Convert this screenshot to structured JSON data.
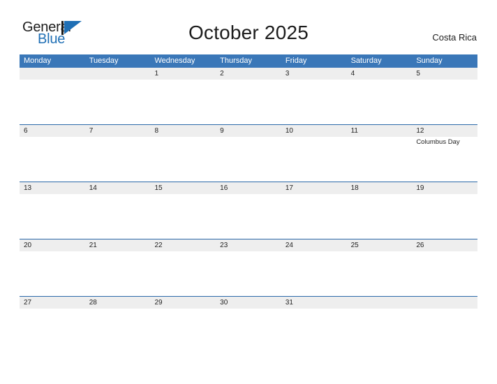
{
  "brand": {
    "name_part1": "General",
    "name_part2": "Blue",
    "flag_icon": "blue-triangle-flag-icon",
    "color_dark": "#1c1c1c",
    "color_blue": "#1f6fb5"
  },
  "header": {
    "title": "October 2025",
    "region": "Costa Rica"
  },
  "theme": {
    "header_bar": "#3a77b8",
    "week_band": "#eeeeee",
    "rule": "#2a68a8",
    "page_background": "#ffffff",
    "text": "#222222"
  },
  "calendar": {
    "month": "October",
    "year": "2025",
    "week_start": "Monday",
    "weekdays": [
      "Monday",
      "Tuesday",
      "Wednesday",
      "Thursday",
      "Friday",
      "Saturday",
      "Sunday"
    ],
    "weeks": [
      {
        "days": [
          {
            "num": "",
            "events": []
          },
          {
            "num": "",
            "events": []
          },
          {
            "num": "1",
            "events": []
          },
          {
            "num": "2",
            "events": []
          },
          {
            "num": "3",
            "events": []
          },
          {
            "num": "4",
            "events": []
          },
          {
            "num": "5",
            "events": []
          }
        ]
      },
      {
        "days": [
          {
            "num": "6",
            "events": []
          },
          {
            "num": "7",
            "events": []
          },
          {
            "num": "8",
            "events": []
          },
          {
            "num": "9",
            "events": []
          },
          {
            "num": "10",
            "events": []
          },
          {
            "num": "11",
            "events": []
          },
          {
            "num": "12",
            "events": [
              "Columbus Day"
            ]
          }
        ]
      },
      {
        "days": [
          {
            "num": "13",
            "events": []
          },
          {
            "num": "14",
            "events": []
          },
          {
            "num": "15",
            "events": []
          },
          {
            "num": "16",
            "events": []
          },
          {
            "num": "17",
            "events": []
          },
          {
            "num": "18",
            "events": []
          },
          {
            "num": "19",
            "events": []
          }
        ]
      },
      {
        "days": [
          {
            "num": "20",
            "events": []
          },
          {
            "num": "21",
            "events": []
          },
          {
            "num": "22",
            "events": []
          },
          {
            "num": "23",
            "events": []
          },
          {
            "num": "24",
            "events": []
          },
          {
            "num": "25",
            "events": []
          },
          {
            "num": "26",
            "events": []
          }
        ]
      },
      {
        "days": [
          {
            "num": "27",
            "events": []
          },
          {
            "num": "28",
            "events": []
          },
          {
            "num": "29",
            "events": []
          },
          {
            "num": "30",
            "events": []
          },
          {
            "num": "31",
            "events": []
          },
          {
            "num": "",
            "events": []
          },
          {
            "num": "",
            "events": []
          }
        ]
      }
    ]
  }
}
